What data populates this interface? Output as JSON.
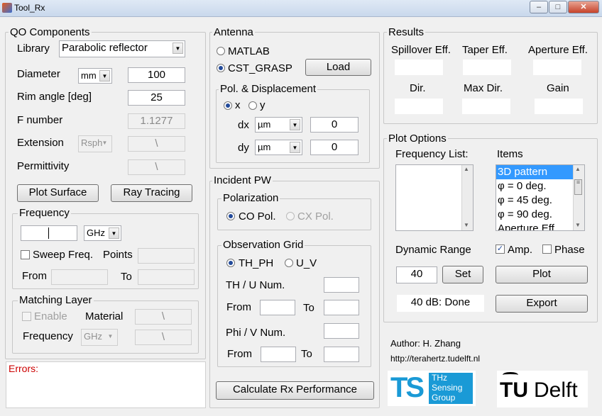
{
  "window": {
    "title": "Tool_Rx",
    "btn_min": "–",
    "btn_max": "□",
    "btn_close": "✕"
  },
  "qo": {
    "title": "QO Components",
    "library_label": "Library",
    "library_value": "Parabolic reflector",
    "diameter_label": "Diameter",
    "diameter_unit": "mm",
    "diameter_value": "100",
    "rim_label": "Rim angle [deg]",
    "rim_value": "25",
    "fnum_label": "F number",
    "fnum_value": "1.1277",
    "ext_label": "Extension",
    "ext_value": "Rsph",
    "ext_box": "\\",
    "perm_label": "Permittivity",
    "perm_box": "\\",
    "plot_surface": "Plot Surface",
    "ray_tracing": "Ray Tracing"
  },
  "frequency": {
    "title": "Frequency",
    "value": "",
    "unit": "GHz",
    "sweep": "Sweep Freq.",
    "points": "Points",
    "from": "From",
    "to": "To"
  },
  "matching": {
    "title": "Matching Layer",
    "enable": "Enable",
    "material": "Material",
    "material_box": "\\",
    "frequency": "Frequency",
    "unit": "GHz",
    "freq_box": "\\"
  },
  "errors": {
    "label": "Errors:"
  },
  "antenna": {
    "title": "Antenna",
    "opt_matlab": "MATLAB",
    "opt_cst": "CST_GRASP",
    "load": "Load",
    "pol_title": "Pol. & Displacement",
    "pol_x": "x",
    "pol_y": "y",
    "dx": "dx",
    "dy": "dy",
    "dx_unit": "µm",
    "dy_unit": "µm",
    "dx_value": "0",
    "dy_value": "0"
  },
  "incident": {
    "title": "Incident PW",
    "pol_title": "Polarization",
    "co": "CO Pol.",
    "cx": "CX Pol.",
    "grid_title": "Observation Grid",
    "th_ph": "TH_PH",
    "u_v": "U_V",
    "thu_num": "TH / U Num.",
    "from1": "From",
    "to1": "To",
    "phiv_num": "Phi / V Num.",
    "from2": "From",
    "to2": "To"
  },
  "calc": "Calculate Rx Performance",
  "results": {
    "title": "Results",
    "spill": "Spillover Eff.",
    "taper": "Taper Eff.",
    "aperture": "Aperture Eff.",
    "dir": "Dir.",
    "maxdir": "Max Dir.",
    "gain": "Gain"
  },
  "plot": {
    "title": "Plot Options",
    "freq_list": "Frequency List:",
    "items_label": "Items",
    "items": [
      "3D pattern",
      "φ = 0 deg.",
      "φ = 45 deg.",
      "φ = 90 deg.",
      "Aperture Eff."
    ],
    "dyn_range": "Dynamic Range",
    "amp": "Amp.",
    "phase": "Phase",
    "dyn_value": "40",
    "set": "Set",
    "plot_btn": "Plot",
    "status": "40 dB: Done",
    "export": "Export"
  },
  "author": {
    "name": "Author: H. Zhang",
    "url": "http://terahertz.tudelft.nl"
  },
  "logos": {
    "ts": "TS",
    "ts_lines": [
      "THz",
      "Sensing",
      "Group"
    ],
    "tu": "TU",
    "delft": "Delft"
  },
  "colors": {
    "selection": "#3399ff",
    "error_text": "#cc0000",
    "ts_blue": "#1a9ad6",
    "radio_dot": "#224a9a"
  }
}
